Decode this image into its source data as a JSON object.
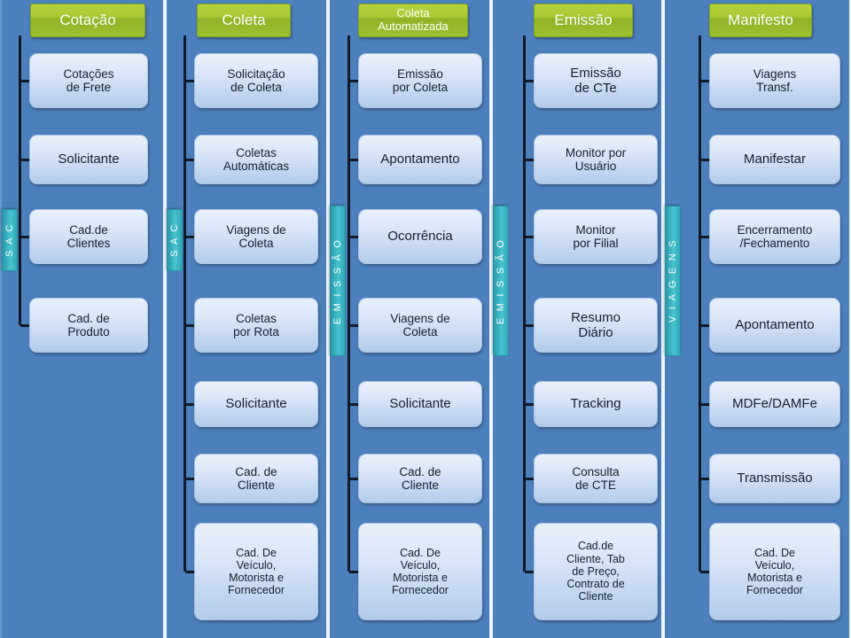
{
  "diagram": {
    "title": "Fluxo de Processos - Cotacao, Coleta, Emissao, Manifesto",
    "background_color": "#4c80bd",
    "header_color": "#a8c832",
    "node_color": "#dbe7f8",
    "lane_color": "#37b0bf",
    "connector_color": "#111a2a"
  },
  "columns": [
    {
      "id": "cotacao",
      "header": "Cotação",
      "lane_label": "S A C",
      "nodes": [
        {
          "label": "Cotações\nde Frete"
        },
        {
          "label": "Solicitante"
        },
        {
          "label": "Cad.de\nClientes"
        },
        {
          "label": "Cad. de\nProduto"
        }
      ]
    },
    {
      "id": "coleta",
      "header": "Coleta",
      "lane_label": "S A C",
      "nodes": [
        {
          "label": "Solicitação\nde Coleta"
        },
        {
          "label": "Coletas\nAutomáticas"
        },
        {
          "label": "Viagens de\nColeta"
        },
        {
          "label": "Coletas\npor Rota"
        },
        {
          "label": "Solicitante"
        },
        {
          "label": "Cad. de\nCliente"
        },
        {
          "label": "Cad. De\nVeículo,\nMotorista e\nFornecedor"
        }
      ]
    },
    {
      "id": "coleta-automatizada",
      "header": "Coleta\nAutomatizada",
      "lane_label": "E M I S S Ã O",
      "nodes": [
        {
          "label": "Emissão\npor Coleta"
        },
        {
          "label": "Apontamento"
        },
        {
          "label": "Ocorrência"
        },
        {
          "label": "Viagens de\nColeta"
        },
        {
          "label": "Solicitante"
        },
        {
          "label": "Cad. de\nCliente"
        },
        {
          "label": "Cad. De\nVeículo,\nMotorista e\nFornecedor"
        }
      ]
    },
    {
      "id": "emissao",
      "header": "Emissão",
      "lane_label": "E M I S S Ã O",
      "nodes": [
        {
          "label": "Emissão\nde CTe"
        },
        {
          "label": "Monitor por\nUsuário"
        },
        {
          "label": "Monitor\npor Filial"
        },
        {
          "label": "Resumo\nDiário"
        },
        {
          "label": "Tracking"
        },
        {
          "label": "Consulta\nde CTE"
        },
        {
          "label": "Cad.de\nCliente, Tab\nde Preço,\nContrato de\nCliente"
        }
      ]
    },
    {
      "id": "manifesto",
      "header": "Manifesto",
      "lane_label": "V I A G E N S",
      "nodes": [
        {
          "label": "Viagens\nTransf."
        },
        {
          "label": "Manifestar"
        },
        {
          "label": "Encerramento\n/Fechamento"
        },
        {
          "label": "Apontamento"
        },
        {
          "label": "MDFe/DAMFe"
        },
        {
          "label": "Transmissão"
        },
        {
          "label": "Cad. De\nVeículo,\nMotorista e\nFornecedor"
        }
      ]
    }
  ]
}
